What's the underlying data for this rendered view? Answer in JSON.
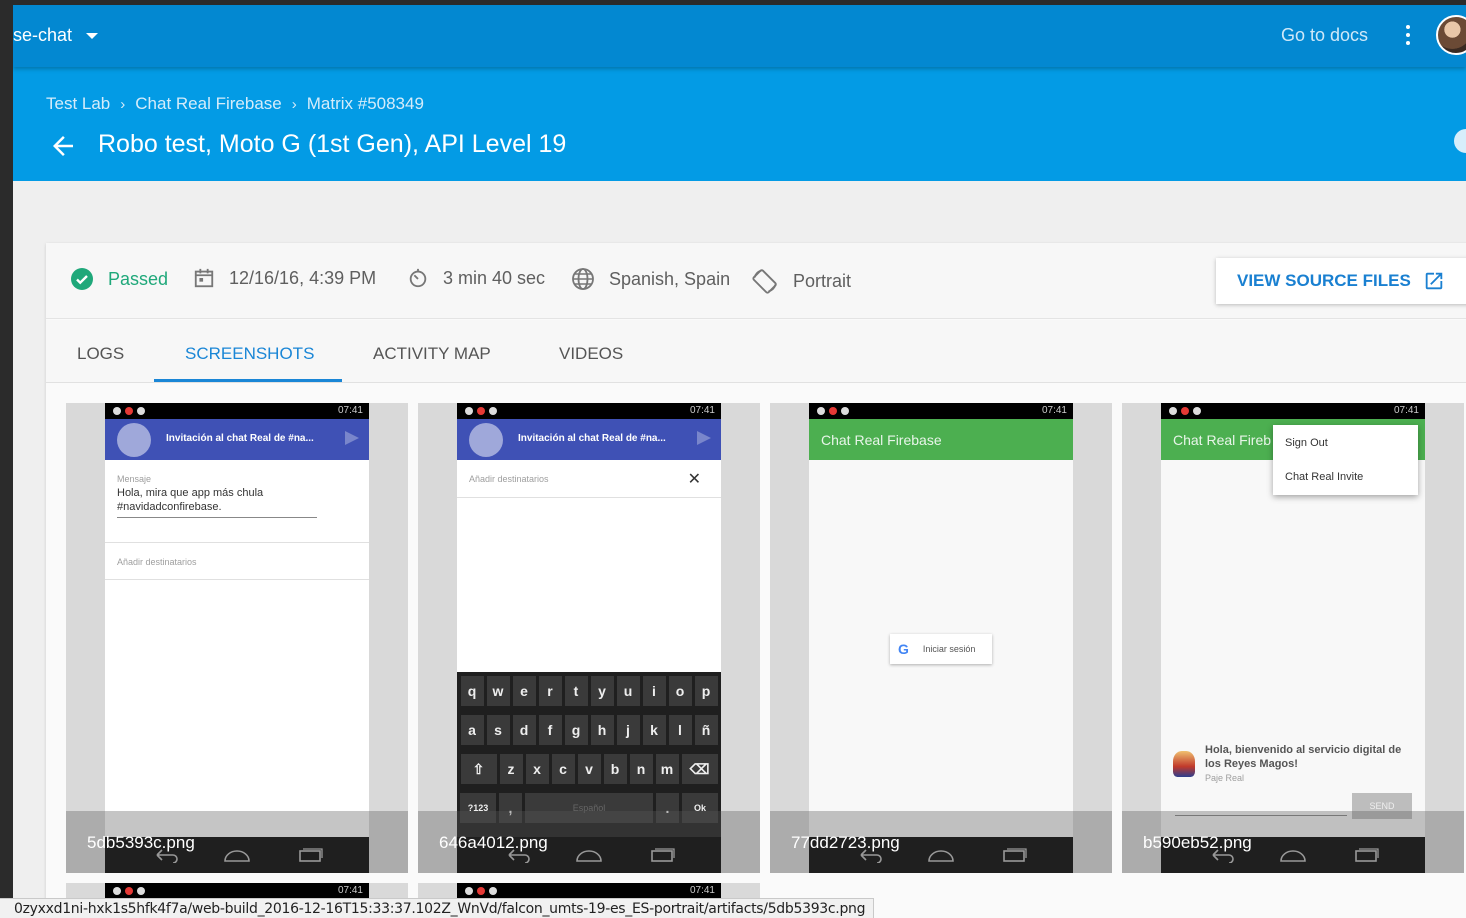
{
  "topbar": {
    "project": "se-chat",
    "docs": "Go to docs"
  },
  "header": {
    "breadcrumbs": [
      "Test Lab",
      "Chat Real Firebase",
      "Matrix #508349"
    ],
    "title": "Robo test, Moto G (1st Gen), API Level 19"
  },
  "summary": {
    "status": "Passed",
    "date": "12/16/16, 4:39 PM",
    "duration": "3 min 40 sec",
    "locale": "Spanish, Spain",
    "orientation": "Portrait",
    "source_button": "VIEW SOURCE FILES"
  },
  "tabs": [
    "LOGS",
    "SCREENSHOTS",
    "ACTIVITY MAP",
    "VIDEOS"
  ],
  "colors": {
    "appbar": "#0388d1",
    "header": "#039be5",
    "passed": "#1fa87a",
    "accent": "#1a86d6"
  },
  "screenshots": [
    {
      "filename": "5db5393c.png",
      "clock": "07:41",
      "bar_title": "Invitación al chat Real de #na...",
      "field_label": "Mensaje",
      "message": "Hola, mira que app más chula #navidadconfirebase.",
      "recipients": "Añadir destinatarios"
    },
    {
      "filename": "646a4012.png",
      "clock": "07:41",
      "bar_title": "Invitación al chat Real de #na...",
      "recipients": "Añadir destinatarios",
      "keys_row1": [
        "q",
        "w",
        "e",
        "r",
        "t",
        "y",
        "u",
        "i",
        "o",
        "p"
      ],
      "keys_row2": [
        "a",
        "s",
        "d",
        "f",
        "g",
        "h",
        "j",
        "k",
        "l",
        "ñ"
      ],
      "keys_row3": [
        "z",
        "x",
        "c",
        "v",
        "b",
        "n",
        "m"
      ],
      "key_numbers": "?123",
      "key_comma": ",",
      "key_space": "Español",
      "key_period": ".",
      "key_ok": "Ok"
    },
    {
      "filename": "77dd2723.png",
      "clock": "07:41",
      "bar_title": "Chat Real Firebase",
      "signin": "Iniciar sesión"
    },
    {
      "filename": "b590eb52.png",
      "clock": "07:41",
      "bar_title": "Chat Real Fireb",
      "menu_item1": "Sign Out",
      "menu_item2": "Chat Real Invite",
      "welcome": "Hola, bienvenido al servicio digital de los Reyes Magos!",
      "author": "Paje Real",
      "send": "SEND"
    }
  ],
  "status_url": "0zyxxd1ni-hxk1s5hfk4f7a/web-build_2016-12-16T15:33:37.102Z_WnVd/falcon_umts-19-es_ES-portrait/artifacts/5db5393c.png"
}
